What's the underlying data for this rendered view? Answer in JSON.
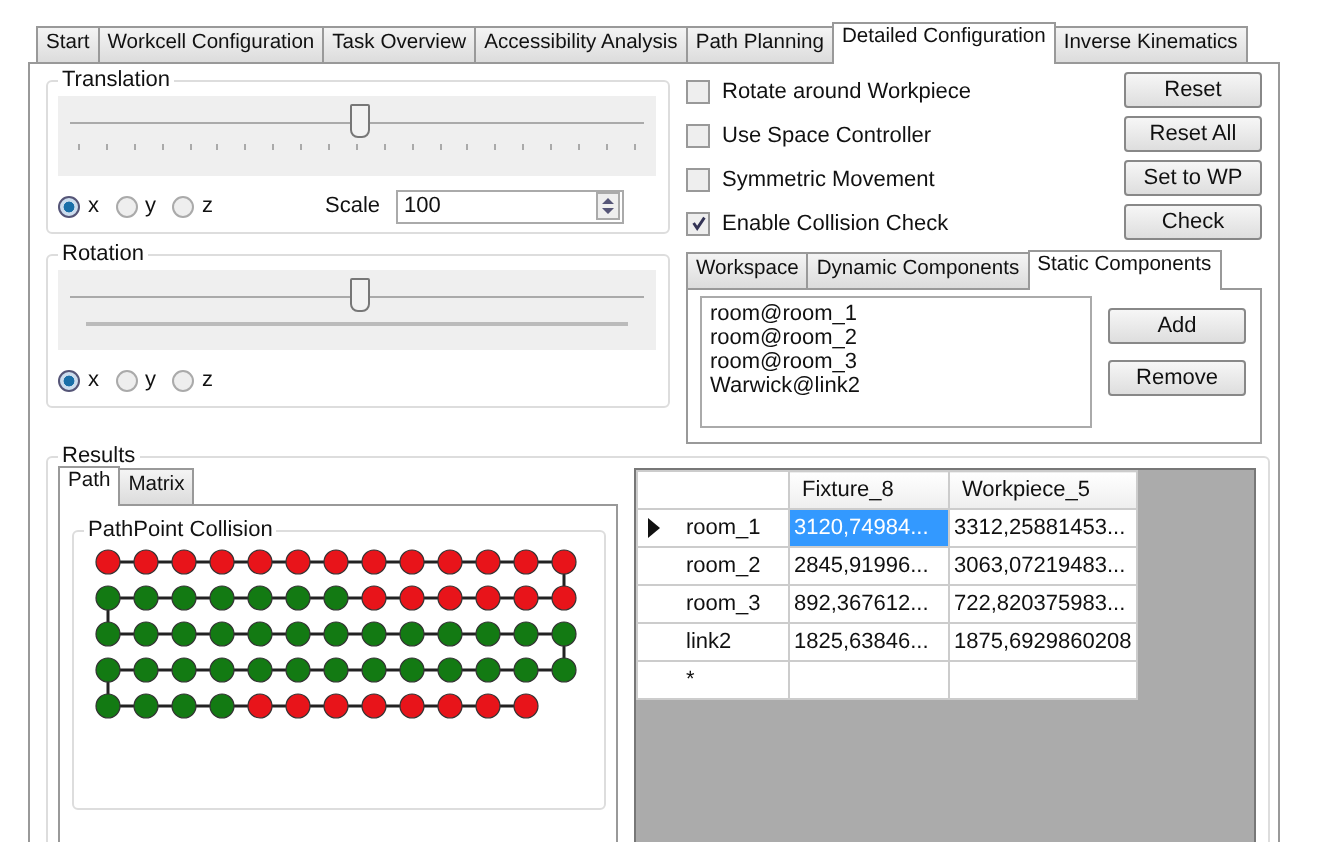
{
  "tabs": [
    {
      "label": "Start",
      "selected": false
    },
    {
      "label": "Workcell Configuration",
      "selected": false
    },
    {
      "label": "Task Overview",
      "selected": false
    },
    {
      "label": "Accessibility Analysis",
      "selected": false
    },
    {
      "label": "Path Planning",
      "selected": false
    },
    {
      "label": "Detailed Configuration",
      "selected": true
    },
    {
      "label": "Inverse Kinematics",
      "selected": false
    }
  ],
  "translation": {
    "title": "Translation",
    "level": 0.5,
    "axes": [
      {
        "label": "x",
        "selected": true
      },
      {
        "label": "y",
        "selected": false
      },
      {
        "label": "z",
        "selected": false
      }
    ],
    "scale_label": "Scale",
    "scale_value": "100"
  },
  "rotation": {
    "title": "Rotation",
    "level": 0.5,
    "axes": [
      {
        "label": "x",
        "selected": true
      },
      {
        "label": "y",
        "selected": false
      },
      {
        "label": "z",
        "selected": false
      }
    ]
  },
  "options": [
    {
      "label": "Rotate around Workpiece",
      "checked": false
    },
    {
      "label": "Use Space Controller",
      "checked": false
    },
    {
      "label": "Symmetric Movement",
      "checked": false
    },
    {
      "label": "Enable Collision Check",
      "checked": true
    }
  ],
  "side_buttons": [
    "Reset",
    "Reset All",
    "Set to WP",
    "Check"
  ],
  "component_tabs": [
    {
      "label": "Workspace",
      "selected": false
    },
    {
      "label": "Dynamic Components",
      "selected": false
    },
    {
      "label": "Static Components",
      "selected": true
    }
  ],
  "components": [
    "room@room_1",
    "room@room_2",
    "room@room_3",
    "Warwick@link2"
  ],
  "component_buttons": [
    "Add",
    "Remove"
  ],
  "results": {
    "title": "Results",
    "tabs": [
      {
        "label": "Path",
        "selected": true
      },
      {
        "label": "Matrix",
        "selected": false
      }
    ],
    "collision_title": "PathPoint Collision",
    "path_rows": [
      [
        true,
        true,
        true,
        true,
        true,
        true,
        true,
        true,
        true,
        true,
        true,
        true,
        true
      ],
      [
        false,
        false,
        false,
        false,
        false,
        false,
        false,
        true,
        true,
        true,
        true,
        true,
        true
      ],
      [
        false,
        false,
        false,
        false,
        false,
        false,
        false,
        false,
        false,
        false,
        false,
        false,
        false
      ],
      [
        false,
        false,
        false,
        false,
        false,
        false,
        false,
        false,
        false,
        false,
        false,
        false,
        false
      ],
      [
        false,
        false,
        false,
        false,
        true,
        true,
        true,
        true,
        true,
        true,
        true,
        true
      ]
    ],
    "table": {
      "columns": [
        "Fixture_8",
        "Workpiece_5"
      ],
      "rows": [
        {
          "label": "room_1",
          "current": true,
          "cells": [
            {
              "text": "3120,74984...",
              "selected": true
            },
            {
              "text": "3312,25881453...",
              "selected": false
            }
          ]
        },
        {
          "label": "room_2",
          "current": false,
          "cells": [
            {
              "text": "2845,91996...",
              "selected": false
            },
            {
              "text": "3063,07219483...",
              "selected": false
            }
          ]
        },
        {
          "label": "room_3",
          "current": false,
          "cells": [
            {
              "text": "892,367612...",
              "selected": false
            },
            {
              "text": "722,820375983...",
              "selected": false
            }
          ]
        },
        {
          "label": "link2",
          "current": false,
          "cells": [
            {
              "text": "1825,63846...",
              "selected": false
            },
            {
              "text": "1875,6929860208",
              "selected": false
            }
          ]
        }
      ],
      "new_row_marker": "*"
    }
  }
}
